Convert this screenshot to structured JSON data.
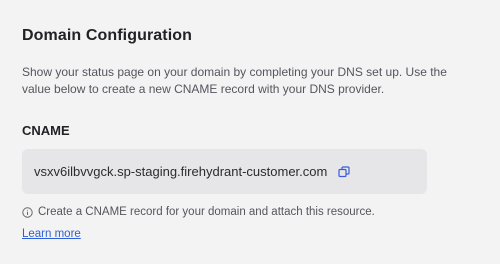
{
  "section": {
    "title": "Domain Configuration",
    "description": "Show your status page on your domain by completing your DNS set up. Use the value below to create a new CNAME record with your DNS provider."
  },
  "cname": {
    "label": "CNAME",
    "value": "vsxv6ilbvvgck.sp-staging.firehydrant-customer.com",
    "copy_icon": "copy-icon"
  },
  "hint": {
    "icon": "info-icon",
    "text": "Create a CNAME record for your domain and attach this resource."
  },
  "learn_more": {
    "label": "Learn more"
  },
  "colors": {
    "background": "#f3f3f4",
    "value_box": "#e6e6e9",
    "link": "#2e5fd6",
    "icon_accent": "#3b5bdb"
  }
}
